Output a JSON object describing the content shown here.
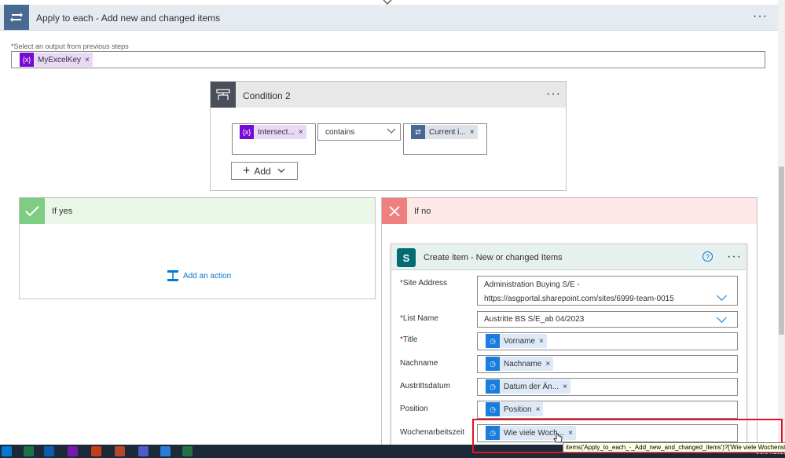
{
  "loop": {
    "title": "Apply to each - Add new and changed items",
    "menu": "···",
    "output_label_star": "*",
    "output_label": "Select an output from previous steps",
    "output_token": "MyExcelKey"
  },
  "condition": {
    "title": "Condition 2",
    "menu": "···",
    "left_token": "Intersect...",
    "operator": "contains",
    "right_token": "Current i...",
    "add_label": "Add"
  },
  "if_yes": {
    "title": "If yes",
    "add_action": "Add an action"
  },
  "if_no": {
    "title": "If no"
  },
  "create_item": {
    "title": "Create item - New or changed Items",
    "help": "?",
    "menu": "···",
    "site_address_label": "Site Address",
    "site_address_line1": "Administration Buying S/E -",
    "site_address_line2": "https://asgportal.sharepoint.com/sites/6999-team-0015",
    "list_name_label": "List Name",
    "list_name_value": "Austritte BS S/E_ab 04/2023",
    "fields": [
      {
        "label": "Title",
        "required": "*",
        "token": "Vorname"
      },
      {
        "label": "Nachname",
        "required": "",
        "token": "Nachname"
      },
      {
        "label": "Austrittsdatum",
        "required": "",
        "token": "Datum der Än..."
      },
      {
        "label": "Position",
        "required": "",
        "token": "Position"
      },
      {
        "label": "Wochenarbeitszeit",
        "required": "",
        "token": "Wie viele Woch..."
      }
    ]
  },
  "tooltip": "items('Apply_to_each_-_Add_new_and_changed_items')?['Wie viele Wochenstunden?']",
  "taskbar": {
    "date": "06.04.2023"
  },
  "colors": {
    "loop_accent": "#486991",
    "condition_accent": "#484f58",
    "yes_accent": "#7fcc83",
    "no_accent": "#f08080",
    "sharepoint": "#036c70",
    "token_purple": "#770bd6",
    "token_blue": "#1a7dde",
    "link_blue": "#0078d4",
    "highlight_red": "#e81123"
  },
  "icons": {
    "loop": "loop-icon",
    "condition": "condition-icon",
    "yes": "checkmark-icon",
    "no": "close-icon",
    "sharepoint": "sharepoint-icon",
    "variable": "variable-icon",
    "form_field": "clock-icon"
  }
}
